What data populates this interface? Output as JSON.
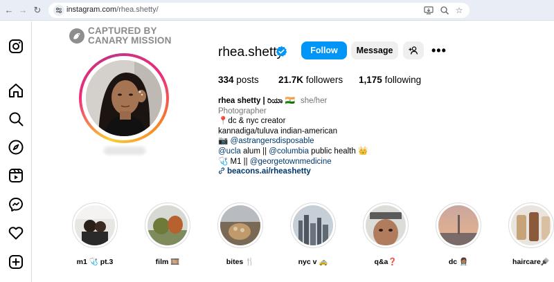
{
  "browser": {
    "url_host": "instagram.com",
    "url_path": "/rhea.shetty/"
  },
  "watermark": {
    "line1": "CAPTURED BY",
    "line2": "CANARY MISSION"
  },
  "profile": {
    "username": "rhea.shetty",
    "follow_label": "Follow",
    "message_label": "Message",
    "more_label": "•••",
    "stats": {
      "posts_value": "334",
      "posts_label": "posts",
      "followers_value": "21.7K",
      "followers_label": "followers",
      "following_value": "1,175",
      "following_label": "following"
    },
    "bio": {
      "name": "rhea shetty | ರಿಯಾ 🇮🇳",
      "pronouns": "she/her",
      "category": "Photographer",
      "line1": "📍dc & nyc creator",
      "line2": "kannadiga/tuluva indian-american",
      "line3_prefix": "📷",
      "line3_link": "@astrangersdisposable",
      "line4_link1": "@ucla",
      "line4_mid": " alum || ",
      "line4_link2": "@columbia",
      "line4_suffix": " public health 👑",
      "line5_prefix": "🩺 M1 || ",
      "line5_link": "@georgetownmedicine",
      "website": "beacons.ai/rheashetty"
    }
  },
  "highlights": [
    {
      "label": "m1 🩺 pt.3"
    },
    {
      "label": "film 🎞️"
    },
    {
      "label": "bites 🍴"
    },
    {
      "label": "nyc v 🚕"
    },
    {
      "label": "q&a❓"
    },
    {
      "label": "dc 👩🏽‍⚕️"
    },
    {
      "label": "haircare🪮"
    }
  ],
  "colors": {
    "accent": "#0095f6",
    "link": "#00376b",
    "muted": "#737373"
  }
}
